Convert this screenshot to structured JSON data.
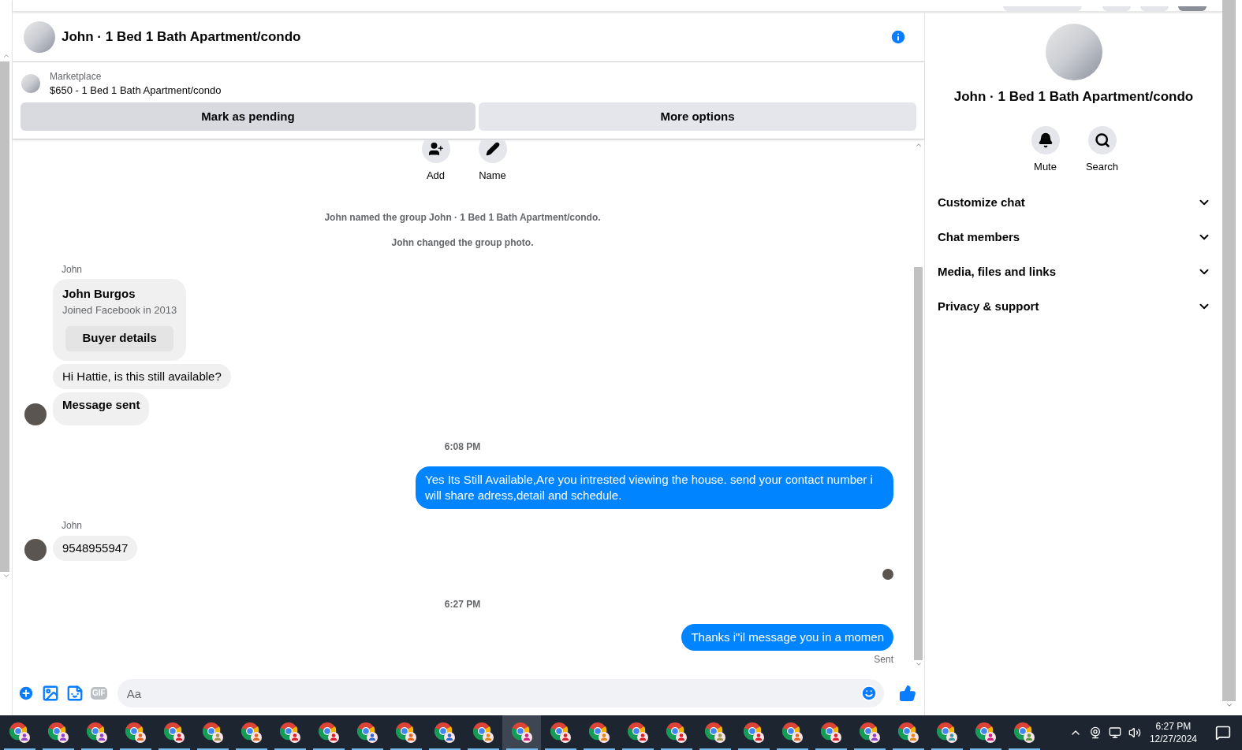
{
  "header": {
    "title": "John · 1 Bed 1 Bath Apartment/condo"
  },
  "listing": {
    "source": "Marketplace",
    "title": "$650 - 1 Bed 1 Bath Apartment/condo"
  },
  "listing_buttons": [
    "Mark as pending",
    "More options"
  ],
  "group_actions": [
    {
      "kind": "add",
      "label": "Add"
    },
    {
      "kind": "name",
      "label": "Name"
    }
  ],
  "messages": [
    {
      "kind": "system",
      "text": "John named the group John · 1 Bed 1 Bath Apartment/condo."
    },
    {
      "kind": "system",
      "text": "John changed the group photo."
    },
    {
      "kind": "sender",
      "text": "John"
    },
    {
      "kind": "card",
      "name": "John Burgos",
      "subtitle": "Joined Facebook in 2013",
      "button": "Buyer details"
    },
    {
      "kind": "incoming",
      "text": "Hi Hattie, is this still available?",
      "avatar": false,
      "bold": false
    },
    {
      "kind": "incoming",
      "text": "Message sent",
      "avatar": true,
      "bold": true
    },
    {
      "kind": "time",
      "text": "6:08 PM"
    },
    {
      "kind": "outgoing",
      "text": "Yes Its Still Available,Are you intrested viewing the house. send your contact number i will share adress,detail and schedule."
    },
    {
      "kind": "sender",
      "text": "John"
    },
    {
      "kind": "incoming",
      "text": "9548955947",
      "avatar": true,
      "bold": false
    },
    {
      "kind": "seen"
    },
    {
      "kind": "time",
      "text": "6:27 PM"
    },
    {
      "kind": "outgoing",
      "text": "Thanks i\"il message you in a momen"
    },
    {
      "kind": "status",
      "text": "Sent"
    }
  ],
  "composer": {
    "gif_label": "GIF",
    "placeholder": "Aa"
  },
  "details": {
    "title": "John · 1 Bed 1 Bath Apartment/condo",
    "actions": [
      {
        "kind": "mute",
        "label": "Mute"
      },
      {
        "kind": "search",
        "label": "Search"
      }
    ],
    "sections": [
      {
        "label": "Customize chat",
        "expanded": false
      },
      {
        "label": "Chat members",
        "expanded": false
      },
      {
        "label": "Media, files and links",
        "expanded": false
      },
      {
        "label": "Privacy & support",
        "expanded": false
      }
    ]
  },
  "taskbar": {
    "apps": [
      {
        "color": "#8e44c8",
        "selected": false
      },
      {
        "color": "#8e44c8",
        "selected": false
      },
      {
        "color": "#8e44c8",
        "selected": false
      },
      {
        "color": "#e0681e",
        "selected": false
      },
      {
        "color": "#d8202c",
        "selected": false
      },
      {
        "color": "#a09a50",
        "selected": false
      },
      {
        "color": "#e0681e",
        "selected": false
      },
      {
        "color": "#d8202c",
        "selected": false
      },
      {
        "color": "#d8202c",
        "selected": false
      },
      {
        "color": "#2f6ad0",
        "selected": false
      },
      {
        "color": "#e0681e",
        "selected": false
      },
      {
        "color": "#2f6ad0",
        "selected": false
      },
      {
        "color": "#e0881e",
        "selected": false
      },
      {
        "color": "#d02080",
        "selected": true
      },
      {
        "color": "#d8202c",
        "selected": false
      },
      {
        "color": "#e0881e",
        "selected": false
      },
      {
        "color": "#d8202c",
        "selected": false
      },
      {
        "color": "#d8202c",
        "selected": false
      },
      {
        "color": "#a09a50",
        "selected": false
      },
      {
        "color": "#d8202c",
        "selected": false
      },
      {
        "color": "#e0681e",
        "selected": false
      },
      {
        "color": "#d8202c",
        "selected": false
      },
      {
        "color": "#8e44c8",
        "selected": false
      },
      {
        "color": "#e0881e",
        "selected": false
      },
      {
        "color": "#3a9aa0",
        "selected": false
      },
      {
        "color": "#d02080",
        "selected": false
      },
      {
        "color": "#5a9a40",
        "selected": false
      }
    ],
    "time": "6:27 PM",
    "date": "12/27/2024"
  }
}
